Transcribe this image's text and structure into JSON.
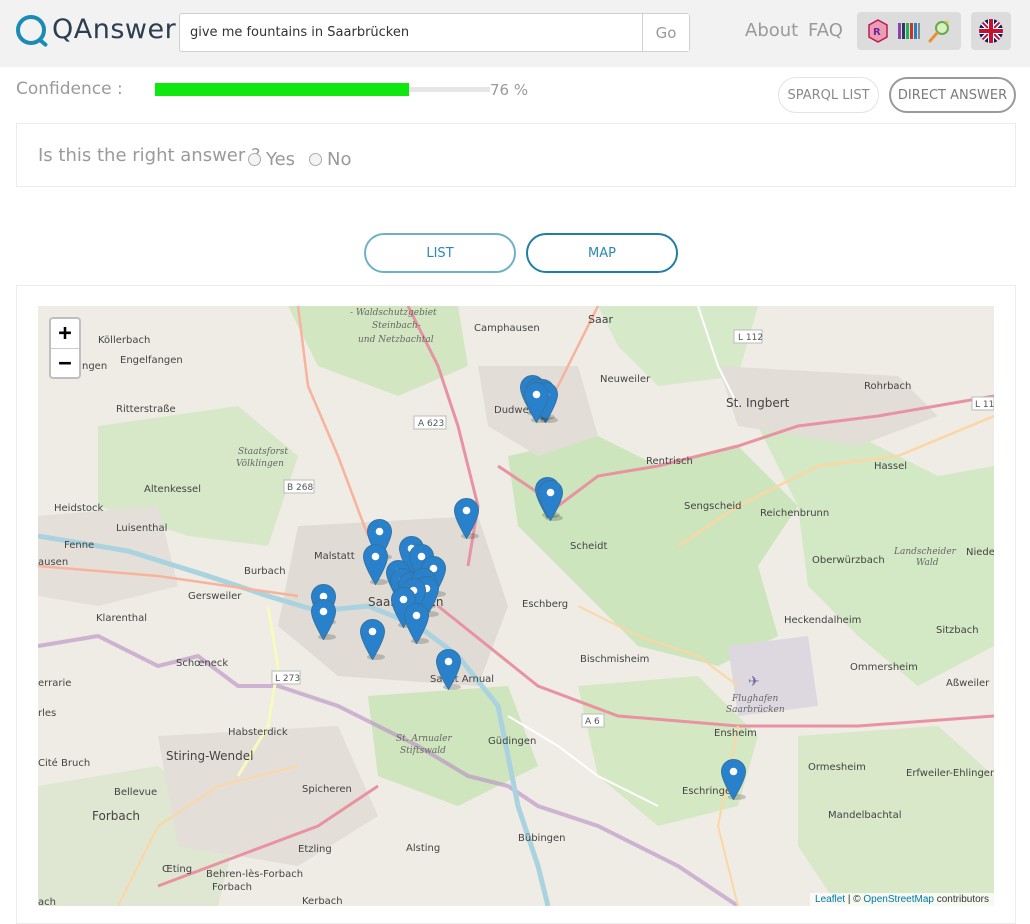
{
  "header": {
    "logo_text": "QAnswer",
    "search_value": "give me fountains in Saarbrücken",
    "go_label": "Go",
    "nav": [
      "About",
      "FAQ"
    ],
    "tool_icons": [
      "rdf-icon",
      "library-icon",
      "wand-icon"
    ],
    "language": "uk-flag-icon"
  },
  "confidence": {
    "label": "Confidence :",
    "value": 76,
    "value_text": "76 %",
    "bar_color": "#0fe80f"
  },
  "buttons": {
    "sparql": "SPARQL LIST",
    "direct": "DIRECT ANSWER"
  },
  "feedback": {
    "question": "Is this the right answer ?",
    "yes": "Yes",
    "no": "No"
  },
  "tabs": {
    "list": "LIST",
    "map": "MAP"
  },
  "map": {
    "zoom_in": "+",
    "zoom_out": "−",
    "attribution": {
      "leaflet": "Leaflet",
      "sep": " | © ",
      "osm": "OpenStreetMap",
      "suffix": " contributors"
    },
    "place_labels": [
      "Köllerbach",
      "Engelfangen",
      "Ritterstraße",
      "Altenkessel",
      "Heidstock",
      "Luisenthal",
      "Fenne",
      "Burbach",
      "Malstatt",
      "Gersweiler",
      "Klarenthal",
      "Schœneck",
      "Saarbrücken",
      "Camphausen",
      "Dudweiler",
      "Neuweiler",
      "St. Ingbert",
      "Rohrbach",
      "Hassel",
      "Rentrisch",
      "Sengscheid",
      "Reichenbrunn",
      "Scheidt",
      "Eschberg",
      "Bischmisheim",
      "Oberwürzbach",
      "Heckendalheim",
      "Sankt Arnual",
      "Güdingen",
      "Ensheim",
      "Ormesheim",
      "Eschringen",
      "Stiring-Wendel",
      "Habsterdick",
      "Forbach",
      "Bellevue",
      "Spicheren",
      "Etzling",
      "Alsting",
      "Kerbach",
      "Behren-lès-Forbach",
      "Bübingen",
      "Mandelbachtal",
      "Erfweiler-Ehlingen",
      "Aßweiler",
      "Sitzbach",
      "Ommersheim",
      "Niede",
      "ngen",
      "ausen",
      "errarie",
      "rles",
      "Cité Bruch",
      "Œting",
      "ach",
      "Saar"
    ],
    "road_labels": [
      "L 112",
      "A 623",
      "B 268",
      "L 273",
      "A 6",
      "L 11"
    ],
    "area_labels": [
      "Waldschutzgebiet Steinbach- und Netzbachtal",
      "Staatsforst Völklingen",
      "Landscheider Wald",
      "Flughafen Saarbrücken",
      "St. Arnualer Stiftswald"
    ],
    "marker_count": 24
  }
}
